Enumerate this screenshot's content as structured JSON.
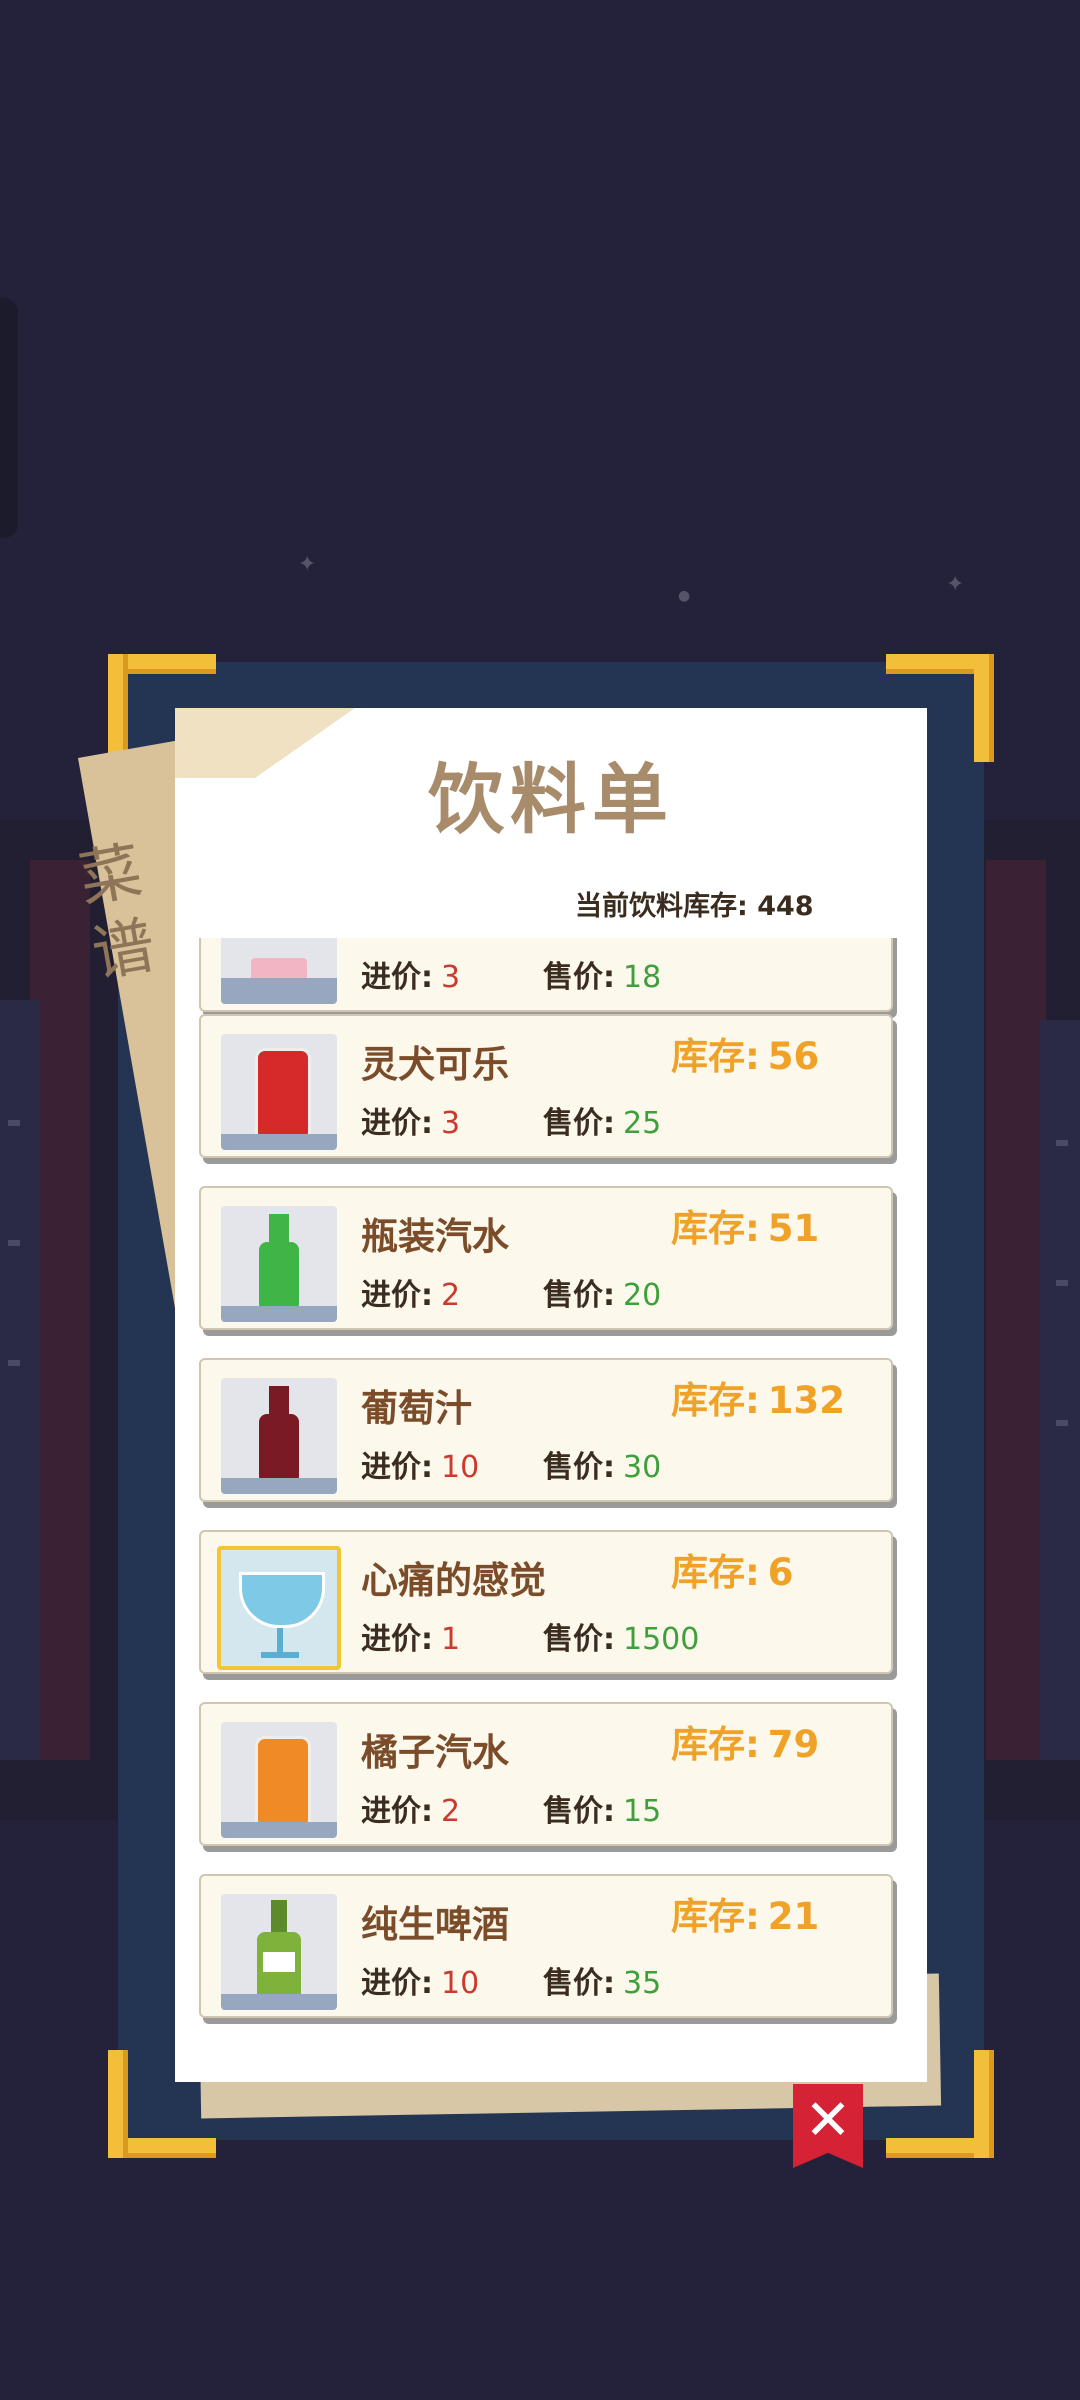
{
  "menu_title": "饮料单",
  "stock_label": "当前饮料库存:",
  "stock_total": "448",
  "recipe_tab": "菜谱",
  "stock_prefix": "库存:",
  "buy_label": "进价:",
  "sell_label": "售价:",
  "close_label": "✕",
  "partial_item": {
    "buy": "3",
    "sell": "18"
  },
  "drinks": [
    {
      "name": "灵犬可乐",
      "stock": "56",
      "buy": "3",
      "sell": "25",
      "icon": "cola-can-icon",
      "color": "#d62a2a"
    },
    {
      "name": "瓶装汽水",
      "stock": "51",
      "buy": "2",
      "sell": "20",
      "icon": "green-soda-bottle-icon",
      "color": "#3fb548"
    },
    {
      "name": "葡萄汁",
      "stock": "132",
      "buy": "10",
      "sell": "30",
      "icon": "grape-juice-bottle-icon",
      "color": "#7a1a24"
    },
    {
      "name": "心痛的感觉",
      "stock": "6",
      "buy": "1",
      "sell": "1500",
      "icon": "wine-glass-icon",
      "color": "#7ec9e6"
    },
    {
      "name": "橘子汽水",
      "stock": "79",
      "buy": "2",
      "sell": "15",
      "icon": "orange-soda-can-icon",
      "color": "#f08a24"
    },
    {
      "name": "纯生啤酒",
      "stock": "21",
      "buy": "10",
      "sell": "35",
      "icon": "beer-bottle-icon",
      "color": "#7fb23a"
    }
  ]
}
